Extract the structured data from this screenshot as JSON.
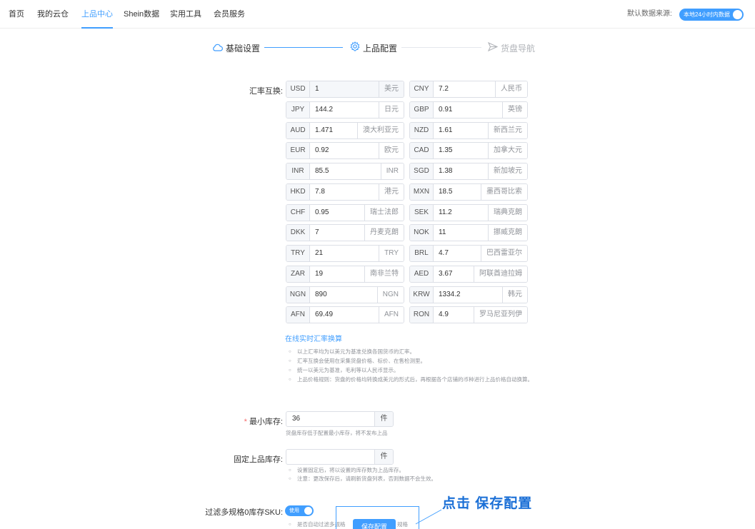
{
  "nav": {
    "items": [
      "首页",
      "我的云仓",
      "上品中心",
      "Shein数据",
      "实用工具",
      "会员服务"
    ],
    "active_index": 2,
    "source_label": "默认数据来源:",
    "source_toggle": "本地24小时内数据"
  },
  "steps": [
    {
      "label": "基础设置",
      "icon": "cloud-icon",
      "state": "done"
    },
    {
      "label": "上品配置",
      "icon": "gear-icon",
      "state": "active"
    },
    {
      "label": "货盘导航",
      "icon": "send-icon",
      "state": "pending"
    }
  ],
  "form": {
    "rates_label": "汇率互换:",
    "rates": [
      {
        "code": "USD",
        "value": "1",
        "unit": "美元"
      },
      {
        "code": "CNY",
        "value": "7.2",
        "unit": "人民币"
      },
      {
        "code": "JPY",
        "value": "144.2",
        "unit": "日元"
      },
      {
        "code": "GBP",
        "value": "0.91",
        "unit": "英镑"
      },
      {
        "code": "AUD",
        "value": "1.471",
        "unit": "澳大利亚元"
      },
      {
        "code": "NZD",
        "value": "1.61",
        "unit": "新西兰元"
      },
      {
        "code": "EUR",
        "value": "0.92",
        "unit": "欧元"
      },
      {
        "code": "CAD",
        "value": "1.35",
        "unit": "加拿大元"
      },
      {
        "code": "INR",
        "value": "85.5",
        "unit": "INR"
      },
      {
        "code": "SGD",
        "value": "1.38",
        "unit": "新加坡元"
      },
      {
        "code": "HKD",
        "value": "7.8",
        "unit": "港元"
      },
      {
        "code": "MXN",
        "value": "18.5",
        "unit": "墨西哥比索"
      },
      {
        "code": "CHF",
        "value": "0.95",
        "unit": "瑞士法郎"
      },
      {
        "code": "SEK",
        "value": "11.2",
        "unit": "瑞典克朗"
      },
      {
        "code": "DKK",
        "value": "7",
        "unit": "丹麦克朗"
      },
      {
        "code": "NOK",
        "value": "11",
        "unit": "挪威克朗"
      },
      {
        "code": "TRY",
        "value": "21",
        "unit": "TRY"
      },
      {
        "code": "BRL",
        "value": "4.7",
        "unit": "巴西雷亚尔"
      },
      {
        "code": "ZAR",
        "value": "19",
        "unit": "南非兰特"
      },
      {
        "code": "AED",
        "value": "3.67",
        "unit": "阿联酋迪拉姆"
      },
      {
        "code": "NGN",
        "value": "890",
        "unit": "NGN"
      },
      {
        "code": "KRW",
        "value": "1334.2",
        "unit": "韩元"
      },
      {
        "code": "AFN",
        "value": "69.49",
        "unit": "AFN"
      },
      {
        "code": "RON",
        "value": "4.9",
        "unit": "罗马尼亚列伊"
      }
    ],
    "online_link": "在线实时汇率换算",
    "notes": [
      "以上汇率均为以美元为基准兑换各国货币的汇率。",
      "汇率互换会使用在采集货盘价格、标价、在售检测里。",
      "统一以美元为基准，毛利等以人民币显示。",
      "上品价格规则：货盘的价格均转换成美元的形式后，再根据各个店铺的币种进行上品价格自动换算。"
    ],
    "min_stock": {
      "label": "最小库存:",
      "value": "36",
      "suffix": "件",
      "hint": "货盘库存低于配置最小库存，将不发布上品"
    },
    "fixed_stock": {
      "label": "固定上品库存:",
      "value": "",
      "suffix": "件",
      "hints": [
        "设置固定后，将以设置的库存数为上品库存。",
        "注意：更改保存后，请刷新货盘列表，否则数据不会生效。"
      ]
    },
    "filter_sku": {
      "label": "过滤多规格0库存SKU:",
      "switch_text": "使用",
      "hint_start": "是否自动过滤多规格",
      "hint_end": "规格"
    },
    "save_button": "保存配置"
  },
  "annotation": {
    "text": "点击 保存配置"
  },
  "colors": {
    "primary": "#409eff",
    "required": "#f56c6c",
    "annotation": "#1a6fd6"
  }
}
